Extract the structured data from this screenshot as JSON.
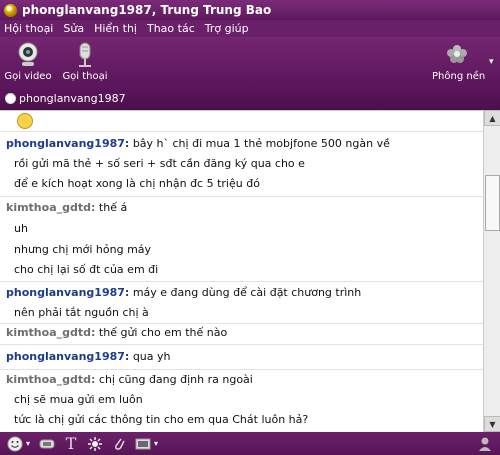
{
  "window": {
    "title": "phonglanvang1987, Trung  Trung Bao"
  },
  "menu": [
    "Hội thoại",
    "Sửa",
    "Hiển thị",
    "Thao tác",
    "Trợ giúp"
  ],
  "toolbar": {
    "video_label": "Gọi video",
    "voice_label": "Gọi thoại",
    "background_label": "Phông nền"
  },
  "contact": {
    "name": "phonglanvang1987"
  },
  "messages": [
    {
      "sender": "phonglanvang1987:",
      "text": "bây h` chị đi mua 1 thẻ mobjfone 500 ngàn về"
    },
    {
      "text": "rồi gửi mã thẻ + số seri + sđt cần đăng ký qua cho e"
    },
    {
      "text": "để e kích hoạt xong là chị nhận đc 5 triệu đó"
    },
    {
      "sender": "kimthoa_gdtd:",
      "text": "thế á"
    },
    {
      "text": "uh"
    },
    {
      "text": "nhưng chị mới hỏng máy"
    },
    {
      "text": "cho chị lại số đt của em đi"
    },
    {
      "sender": "phonglanvang1987:",
      "text": "máy e đang dùng để cài đặt chương trình"
    },
    {
      "text": "nên phải tắt nguồn chị à"
    },
    {
      "sender": "kimthoa_gdtd:",
      "text": "thế gửi cho em thế nào"
    },
    {
      "sender": "phonglanvang1987:",
      "text": "qua yh"
    },
    {
      "sender": "kimthoa_gdtd:",
      "text": "chị cũng đang định ra ngoài"
    },
    {
      "text": "chị sẽ mua gửi em luôn"
    },
    {
      "text": "tức là chị gửi các thông tin cho em qua Chát luôn hả?"
    }
  ]
}
